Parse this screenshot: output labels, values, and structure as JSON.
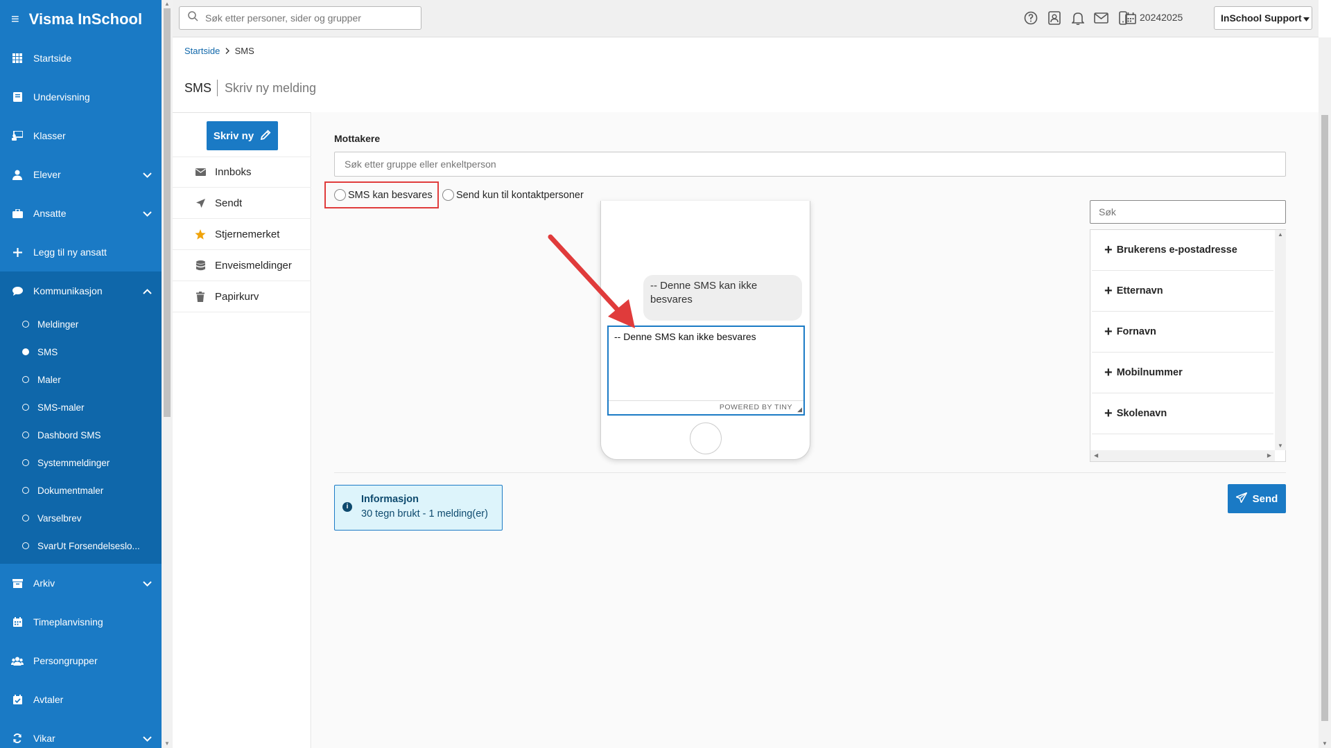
{
  "app": {
    "title": "Visma InSchool"
  },
  "sidebar": {
    "items": [
      {
        "label": "Startside",
        "icon": "grid-icon"
      },
      {
        "label": "Undervisning",
        "icon": "book-icon"
      },
      {
        "label": "Klasser",
        "icon": "classroom-icon"
      },
      {
        "label": "Elever",
        "icon": "student-icon",
        "expandable": true
      },
      {
        "label": "Ansatte",
        "icon": "briefcase-icon",
        "expandable": true
      },
      {
        "label": "Legg til ny ansatt",
        "icon": "plus-icon"
      },
      {
        "label": "Kommunikasjon",
        "icon": "chat-icon",
        "expanded": true
      },
      {
        "label": "Arkiv",
        "icon": "archive-icon",
        "expandable": true
      },
      {
        "label": "Timeplanvisning",
        "icon": "calendar-icon"
      },
      {
        "label": "Persongrupper",
        "icon": "people-icon"
      },
      {
        "label": "Avtaler",
        "icon": "calendar-check-icon"
      },
      {
        "label": "Vikar",
        "icon": "swap-icon",
        "expandable": true
      }
    ],
    "kommunikasjon_sub": [
      {
        "label": "Meldinger"
      },
      {
        "label": "SMS",
        "selected": true
      },
      {
        "label": "Maler"
      },
      {
        "label": "SMS-maler"
      },
      {
        "label": "Dashbord SMS"
      },
      {
        "label": "Systemmeldinger"
      },
      {
        "label": "Dokumentmaler"
      },
      {
        "label": "Varselbrev"
      },
      {
        "label": "SvarUt Forsendelseslo..."
      }
    ]
  },
  "topbar": {
    "search_placeholder": "Søk etter personer, sider og grupper",
    "school_year": "20242025",
    "user_menu": "InSchool Support"
  },
  "breadcrumb": {
    "home": "Startside",
    "current": "SMS"
  },
  "page": {
    "title": "SMS",
    "subtitle": "Skriv ny melding"
  },
  "leftmenu": {
    "new_button": "Skriv ny",
    "items": [
      {
        "label": "Innboks",
        "icon": "envelope-icon"
      },
      {
        "label": "Sendt",
        "icon": "send-arrow-icon"
      },
      {
        "label": "Stjernemerket",
        "icon": "star-icon"
      },
      {
        "label": "Enveismeldinger",
        "icon": "database-icon"
      },
      {
        "label": "Papirkurv",
        "icon": "trash-icon"
      }
    ]
  },
  "compose": {
    "recipients_label": "Mottakere",
    "recipients_placeholder": "Søk etter gruppe eller enkeltperson",
    "checkbox_reply": "SMS kan besvares",
    "checkbox_contacts": "Send kun til kontaktpersoner",
    "preview_bubble": "-- Denne SMS kan ikke besvares",
    "editor_text": "-- Denne SMS kan ikke besvares",
    "editor_status": "POWERED BY TINY",
    "placeholder_search": "Søk",
    "placeholders": [
      "Brukerens e-postadresse",
      "Etternavn",
      "Fornavn",
      "Mobilnummer",
      "Skolenavn"
    ],
    "info_title": "Informasjon",
    "info_text": "30 tegn brukt - 1 melding(er)",
    "send_button": "Send"
  },
  "colors": {
    "brand": "#1a7ac5",
    "sidebar_active": "#0f67aa",
    "highlight": "#e03b3b",
    "info_bg": "#ddf4fb"
  }
}
